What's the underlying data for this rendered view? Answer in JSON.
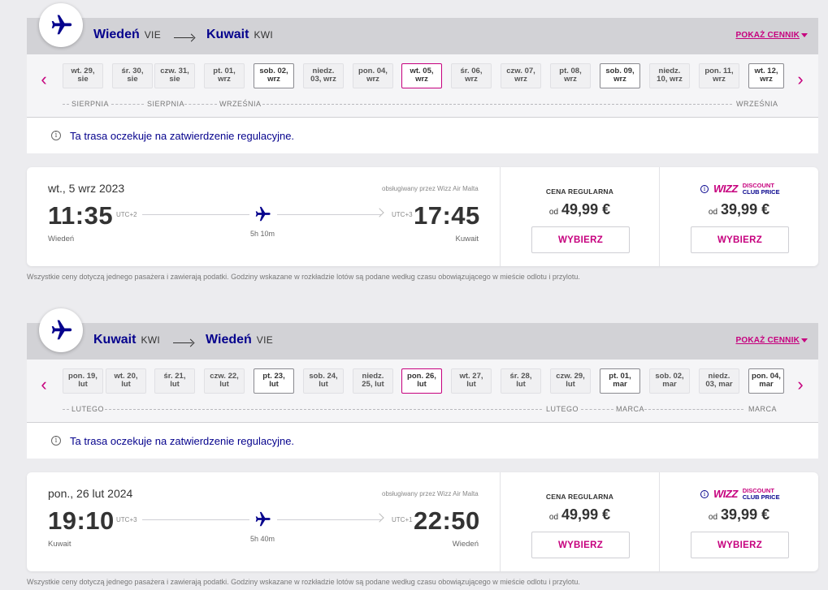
{
  "outbound": {
    "from_city": "Wiedeń",
    "from_code": "VIE",
    "to_city": "Kuwait",
    "to_code": "KWI",
    "pricelist_link": "POKAŻ CENNIK",
    "days": [
      {
        "l1": "wt. 29,",
        "l2": "sie"
      },
      {
        "l1": "śr. 30,",
        "l2": "sie"
      },
      {
        "l1": "czw. 31,",
        "l2": "sie"
      },
      {
        "l1": "pt. 01,",
        "l2": "wrz"
      },
      {
        "l1": "sob. 02,",
        "l2": "wrz"
      },
      {
        "l1": "niedz.",
        "l2": "03, wrz"
      },
      {
        "l1": "pon. 04,",
        "l2": "wrz"
      },
      {
        "l1": "wt. 05,",
        "l2": "wrz"
      },
      {
        "l1": "śr. 06,",
        "l2": "wrz"
      },
      {
        "l1": "czw. 07,",
        "l2": "wrz"
      },
      {
        "l1": "pt. 08,",
        "l2": "wrz"
      },
      {
        "l1": "sob. 09,",
        "l2": "wrz"
      },
      {
        "l1": "niedz.",
        "l2": "10, wrz"
      },
      {
        "l1": "pon. 11,",
        "l2": "wrz"
      },
      {
        "l1": "wt. 12,",
        "l2": "wrz"
      }
    ],
    "months": [
      "SIERPNIA",
      "SIERPNIA",
      "WRZEŚNIA",
      "WRZEŚNIA"
    ],
    "notice": "Ta trasa oczekuje na zatwierdzenie regulacyjne.",
    "flight": {
      "date": "wt., 5 wrz 2023",
      "operated_by": "obsługiwany przez Wizz Air Malta",
      "dep_time": "11:35",
      "dep_utc": "UTC+2",
      "arr_time": "17:45",
      "arr_utc": "UTC+3",
      "duration": "5h 10m",
      "dep_city": "Wiedeń",
      "arr_city": "Kuwait"
    },
    "regular": {
      "label": "CENA REGULARNA",
      "od": "od",
      "price": "49,99 €",
      "button": "WYBIERZ"
    },
    "club": {
      "wizz": "WIZZ",
      "line1": "DISCOUNT",
      "line2": "CLUB PRICE",
      "od": "od",
      "price": "39,99 €",
      "button": "WYBIERZ"
    },
    "disclaimer": "Wszystkie ceny dotyczą jednego pasażera i zawierają podatki. Godziny wskazane w rozkładzie lotów są podane według czasu obowiązującego w mieście odlotu i przylotu."
  },
  "return": {
    "from_city": "Kuwait",
    "from_code": "KWI",
    "to_city": "Wiedeń",
    "to_code": "VIE",
    "pricelist_link": "POKAŻ CENNIK",
    "days": [
      {
        "l1": "pon. 19,",
        "l2": "lut"
      },
      {
        "l1": "wt. 20,",
        "l2": "lut"
      },
      {
        "l1": "śr. 21,",
        "l2": "lut"
      },
      {
        "l1": "czw. 22,",
        "l2": "lut"
      },
      {
        "l1": "pt. 23,",
        "l2": "lut"
      },
      {
        "l1": "sob. 24,",
        "l2": "lut"
      },
      {
        "l1": "niedz.",
        "l2": "25, lut"
      },
      {
        "l1": "pon. 26,",
        "l2": "lut"
      },
      {
        "l1": "wt. 27,",
        "l2": "lut"
      },
      {
        "l1": "śr. 28,",
        "l2": "lut"
      },
      {
        "l1": "czw. 29,",
        "l2": "lut"
      },
      {
        "l1": "pt. 01,",
        "l2": "mar"
      },
      {
        "l1": "sob. 02,",
        "l2": "mar"
      },
      {
        "l1": "niedz.",
        "l2": "03, mar"
      },
      {
        "l1": "pon. 04,",
        "l2": "mar"
      }
    ],
    "months": [
      "LUTEGO",
      "LUTEGO",
      "MARCA",
      "MARCA"
    ],
    "notice": "Ta trasa oczekuje na zatwierdzenie regulacyjne.",
    "flight": {
      "date": "pon., 26 lut 2024",
      "operated_by": "obsługiwany przez Wizz Air Malta",
      "dep_time": "19:10",
      "dep_utc": "UTC+3",
      "arr_time": "22:50",
      "arr_utc": "UTC+1",
      "duration": "5h 40m",
      "dep_city": "Kuwait",
      "arr_city": "Wiedeń"
    },
    "regular": {
      "label": "CENA REGULARNA",
      "od": "od",
      "price": "49,99 €",
      "button": "WYBIERZ"
    },
    "club": {
      "wizz": "WIZZ",
      "line1": "DISCOUNT",
      "line2": "CLUB PRICE",
      "od": "od",
      "price": "39,99 €",
      "button": "WYBIERZ"
    },
    "disclaimer": "Wszystkie ceny dotyczą jednego pasażera i zawierają podatki. Godziny wskazane w rozkładzie lotów są podane według czasu obowiązującego w mieście odlotu i przylotu."
  },
  "colors": {
    "brand_navy": "#06038d",
    "brand_magenta": "#c6007e",
    "route_bar": "#d2d2d6",
    "page_bg": "#ececef"
  },
  "icons": {
    "badge": "plane-icon",
    "flight_path": "plane-icon",
    "nav_prev": "chevron-left-icon",
    "nav_next": "chevron-right-icon",
    "info": "info-icon"
  }
}
